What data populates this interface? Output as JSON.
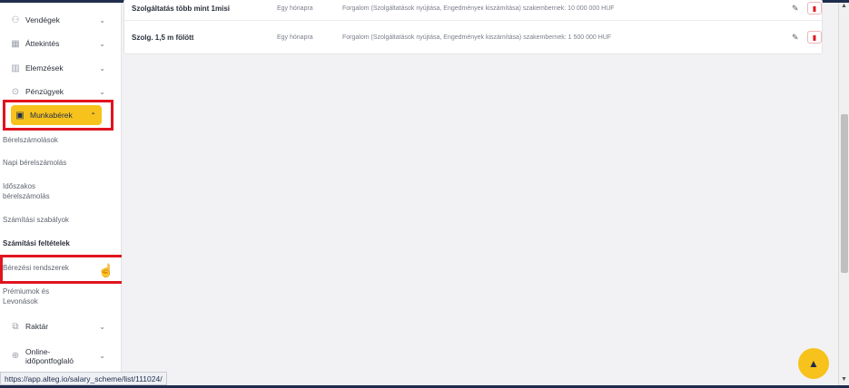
{
  "sidebar": {
    "items": [
      {
        "label": "Vendégek",
        "icon": "users-icon",
        "glyph": "⚇"
      },
      {
        "label": "Áttekintés",
        "icon": "grid-icon",
        "glyph": "▦"
      },
      {
        "label": "Elemzések",
        "icon": "chart-icon",
        "glyph": "▥"
      },
      {
        "label": "Pénzügyek",
        "icon": "money-icon",
        "glyph": "⊙"
      },
      {
        "label": "Munkabérek",
        "icon": "wallet-icon",
        "glyph": "▣"
      },
      {
        "label": "Raktár",
        "icon": "boxes-icon",
        "glyph": "⧉"
      },
      {
        "label": "Online-\nidőpontfoglaló",
        "icon": "globe-icon",
        "glyph": "⊕"
      }
    ],
    "chevron_down": "⌄",
    "chevron_up": "⌃",
    "sub_items": [
      "Bérelszámolások",
      "Napi bérelszámolás",
      "Időszakos\nbérelszámolás",
      "Számítási szabályok",
      "Számítási feltételek",
      "Bérezési rendszerek",
      "Prémiumok és\nLevonások"
    ]
  },
  "table": {
    "rows": [
      {
        "name": "Szolgáltatás több mint 1misi",
        "period": "Egy hónapra",
        "description": "Forgalom (Szolgáltatások nyújtása, Engedményeк kiszámítása) szakembernek: 10 000 000 HUF"
      },
      {
        "name": "Szolg. 1,5 m fölött",
        "period": "Egy hónapra",
        "description": "Forgalom (Szolgáltatások nyújtása, Engedmények kiszámítása) szakembernek: 1 500 000 HUF"
      }
    ],
    "edit_glyph": "✎",
    "delete_glyph": "▮"
  },
  "statusbar": {
    "url": "https://app.alteg.io/salary_scheme/list/111024/"
  },
  "fab": {
    "glyph": "▲"
  },
  "colors": {
    "accent": "#f7c21c",
    "highlight": "#e0141e",
    "navy": "#1f2d4d"
  }
}
